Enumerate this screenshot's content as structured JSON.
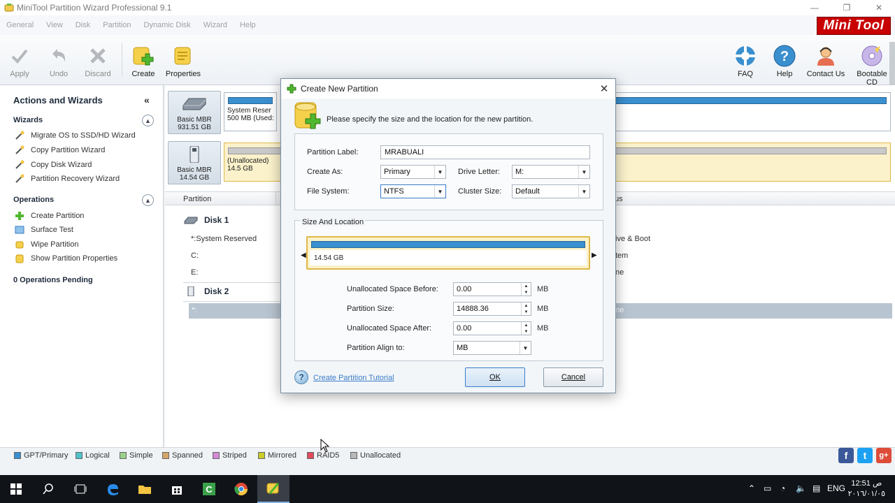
{
  "window": {
    "title": "MiniTool Partition Wizard Professional 9.1",
    "brand": "Mini Tool"
  },
  "menu": [
    "General",
    "View",
    "Disk",
    "Partition",
    "Dynamic Disk",
    "Wizard",
    "Help"
  ],
  "toolbar": {
    "apply": "Apply",
    "undo": "Undo",
    "discard": "Discard",
    "create": "Create",
    "properties": "Properties",
    "faq": "FAQ",
    "help": "Help",
    "contact": "Contact Us",
    "bootable": "Bootable CD"
  },
  "left_panel": {
    "title": "Actions and Wizards",
    "wizards_title": "Wizards",
    "wizards": [
      "Migrate OS to SSD/HD Wizard",
      "Copy Partition Wizard",
      "Copy Disk Wizard",
      "Partition Recovery Wizard"
    ],
    "operations_title": "Operations",
    "operations": [
      "Create Partition",
      "Surface Test",
      "Wipe Partition",
      "Show Partition Properties"
    ],
    "pending": "0 Operations Pending"
  },
  "disks": {
    "disk1": {
      "type": "Basic MBR",
      "size": "931.51 GB",
      "part_name": "System Reser",
      "part_info": "500 MB (Used:"
    },
    "disk2": {
      "type": "Basic MBR",
      "size": "14.54 GB",
      "part_name": "(Unallocated)",
      "part_info": "14.5 GB"
    }
  },
  "table": {
    "col_partition": "Partition",
    "col_status": "tus",
    "disk1_label": "Disk 1",
    "disk2_label": "Disk 2",
    "rows": [
      "*:System Reserved",
      "C:",
      "E:"
    ],
    "status_rows": [
      "ive & Boot",
      "tem",
      "ne",
      "ne"
    ],
    "selected_row": "*:"
  },
  "legend": [
    "GPT/Primary",
    "Logical",
    "Simple",
    "Spanned",
    "Striped",
    "Mirrored",
    "RAID5",
    "Unallocated"
  ],
  "legend_colors": [
    "#3a8fcf",
    "#4fc3c9",
    "#9bd08a",
    "#d4a66a",
    "#d58ad6",
    "#c9cc2a",
    "#e04a5a",
    "#b8b8b8"
  ],
  "dialog": {
    "title": "Create New Partition",
    "header_text": "Please specify the size and the location for the new partition.",
    "partition_label_lbl": "Partition Label:",
    "partition_label_val": "MRABUALI",
    "create_as_lbl": "Create As:",
    "create_as_val": "Primary",
    "drive_letter_lbl": "Drive Letter:",
    "drive_letter_val": "M:",
    "file_system_lbl": "File System:",
    "file_system_val": "NTFS",
    "cluster_size_lbl": "Cluster Size:",
    "cluster_size_val": "Default",
    "size_location_title": "Size And Location",
    "size_bar_label": "14.54 GB",
    "unalloc_before_lbl": "Unallocated Space Before:",
    "unalloc_before_val": "0.00",
    "partition_size_lbl": "Partition Size:",
    "partition_size_val": "14888.36",
    "unalloc_after_lbl": "Unallocated Space After:",
    "unalloc_after_val": "0.00",
    "align_lbl": "Partition Align to:",
    "align_val": "MB",
    "unit": "MB",
    "tutorial_link": "Create Partition Tutorial",
    "ok": "OK",
    "cancel": "Cancel"
  },
  "taskbar": {
    "lang": "ENG",
    "time": "12:51 ص",
    "date": "٢٠١٦/٠١/٠٥"
  }
}
